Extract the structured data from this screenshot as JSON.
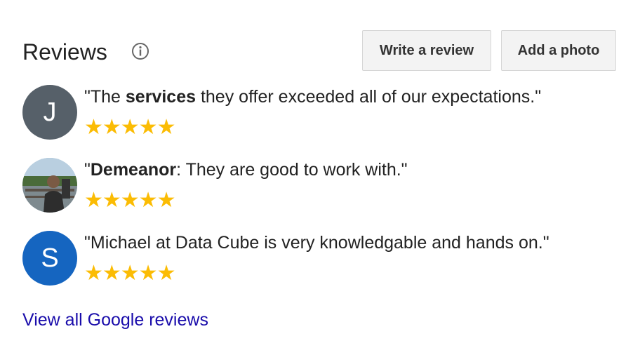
{
  "header": {
    "title": "Reviews",
    "info_icon": "info-circle-icon",
    "write_review_label": "Write a review",
    "add_photo_label": "Add a photo"
  },
  "reviews": [
    {
      "avatar_letter": "J",
      "avatar_color": "#566069",
      "quote_open": "\"The ",
      "quote_bold": "services",
      "quote_rest": " they offer exceeded all of our expectations.\"",
      "rating": 5,
      "stars": "★★★★★"
    },
    {
      "avatar_letter": "",
      "avatar_color": "#6b7a87",
      "avatar_type": "photo",
      "quote_open": "\"",
      "quote_bold": "Demeanor",
      "quote_rest": ": They are good to work with.\"",
      "rating": 5,
      "stars": "★★★★★"
    },
    {
      "avatar_letter": "S",
      "avatar_color": "#1565c0",
      "quote_open": "\"Michael at Data Cube is very knowledgable and hands on.\"",
      "quote_bold": "",
      "quote_rest": "",
      "rating": 5,
      "stars": "★★★★★"
    }
  ],
  "footer": {
    "view_all_label": "View all Google reviews"
  },
  "colors": {
    "star": "#fbbc04",
    "link": "#1a0dab",
    "button_bg": "#f3f3f3"
  }
}
